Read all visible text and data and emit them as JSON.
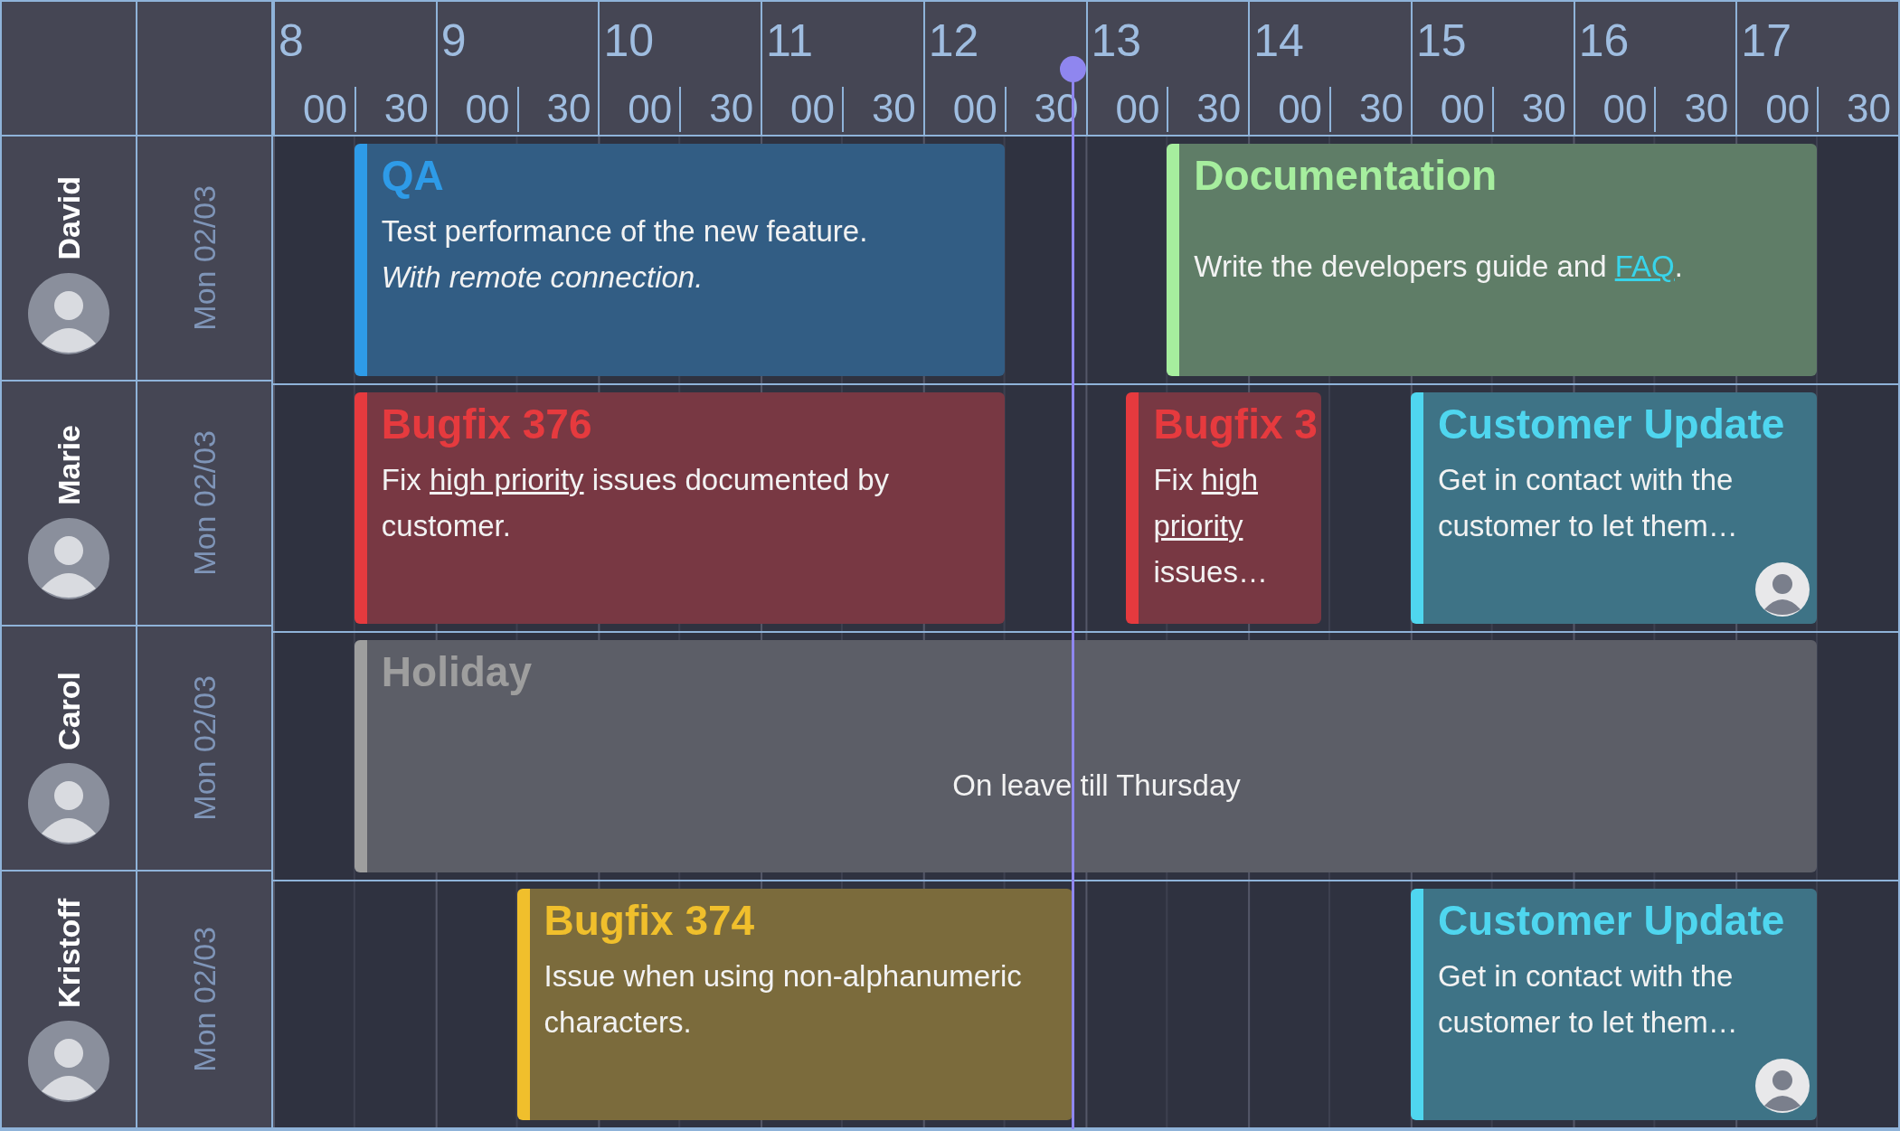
{
  "header": {
    "hours": [
      {
        "hour": "8",
        "minutes": [
          "00",
          "30"
        ]
      },
      {
        "hour": "9",
        "minutes": [
          "00",
          "30"
        ]
      },
      {
        "hour": "10",
        "minutes": [
          "00",
          "30"
        ]
      },
      {
        "hour": "11",
        "minutes": [
          "00",
          "30"
        ]
      },
      {
        "hour": "12",
        "minutes": [
          "00",
          "30"
        ]
      },
      {
        "hour": "13",
        "minutes": [
          "00",
          "30"
        ]
      },
      {
        "hour": "14",
        "minutes": [
          "00",
          "30"
        ]
      },
      {
        "hour": "15",
        "minutes": [
          "00",
          "30"
        ]
      },
      {
        "hour": "16",
        "minutes": [
          "00",
          "30"
        ]
      },
      {
        "hour": "17",
        "minutes": [
          "00",
          "30"
        ]
      }
    ]
  },
  "resources": [
    {
      "name": "David",
      "date": "Mon 02/03",
      "events": [
        {
          "title": "QA",
          "color": "#2e9be8",
          "avatar": false,
          "lines": [
            [
              {
                "text": "Test performance of the new feature.",
                "kind": "plain"
              }
            ],
            [
              {
                "text": "With remote connection.",
                "kind": "italic"
              }
            ]
          ]
        },
        {
          "title": "Documentation",
          "color": "#a6ee9e",
          "avatar": false,
          "lines": [
            [
              {
                "text": "Write the developers guide and ",
                "kind": "plain"
              },
              {
                "text": "FAQ",
                "kind": "link"
              },
              {
                "text": ".",
                "kind": "plain"
              }
            ]
          ]
        }
      ]
    },
    {
      "name": "Marie",
      "date": "Mon 02/03",
      "events": [
        {
          "title": "Bugfix 376",
          "color": "#e63a3e",
          "avatar": false,
          "lines": [
            [
              {
                "text": "Fix ",
                "kind": "plain"
              },
              {
                "text": "high priority",
                "kind": "underline"
              },
              {
                "text": " issues documented by customer.",
                "kind": "plain"
              }
            ]
          ]
        },
        {
          "title": "Bugfix 3",
          "color": "#e63a3e",
          "avatar": false,
          "lines": [
            [
              {
                "text": "Fix ",
                "kind": "plain"
              },
              {
                "text": "high priority",
                "kind": "underline"
              },
              {
                "text": " issues…",
                "kind": "plain"
              }
            ]
          ]
        },
        {
          "title": "Customer Update",
          "color": "#4fd6ef",
          "avatar": true,
          "lines": [
            [
              {
                "text": "Get in contact with the customer to let them…",
                "kind": "plain"
              }
            ]
          ]
        }
      ]
    },
    {
      "name": "Carol",
      "date": "Mon 02/03",
      "events": [
        {
          "title": "Holiday",
          "color": "#9e9e9e",
          "avatar": false,
          "lines": [
            [
              {
                "text": "On leave till Thursday",
                "kind": "plain"
              }
            ]
          ]
        }
      ]
    },
    {
      "name": "Kristoff",
      "date": "Mon 02/03",
      "events": [
        {
          "title": "Bugfix 374",
          "color": "#f0bf2c",
          "avatar": false,
          "lines": [
            [
              {
                "text": "Issue when using non-alphanumeric characters.",
                "kind": "plain"
              }
            ]
          ]
        },
        {
          "title": "Customer Update",
          "color": "#4fd6ef",
          "avatar": true,
          "lines": [
            [
              {
                "text": "Get in contact with the customer to let them…",
                "kind": "plain"
              }
            ]
          ]
        }
      ]
    }
  ]
}
